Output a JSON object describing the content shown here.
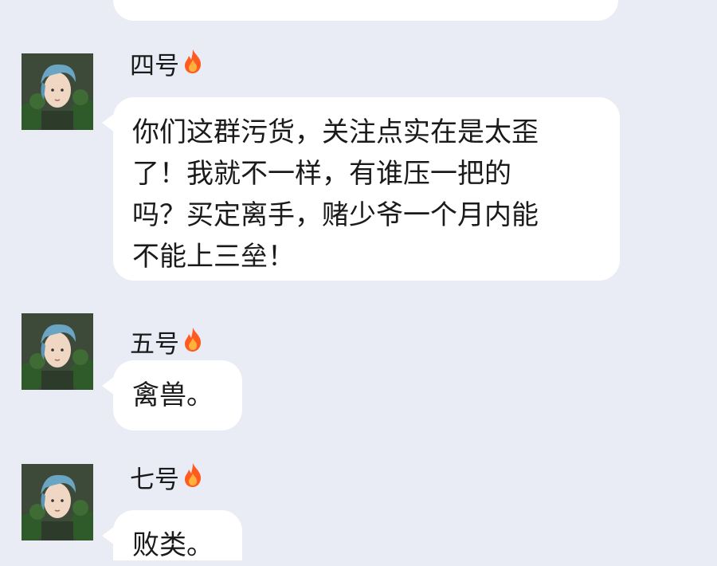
{
  "colors": {
    "background": "#e9ebf5",
    "bubble": "#ffffff",
    "text": "#1a1a1a",
    "flame_outer": "#ff5a1f",
    "flame_inner": "#ffb13b",
    "avatar_hair": "#6aa6c4",
    "avatar_foliage": "#2f5a2a"
  },
  "messages": [
    {
      "sender": "",
      "text": ""
    },
    {
      "sender": "四号",
      "badge_icon": "flame-icon",
      "text": "你们这群污货，关注点实在是太歪\n了！我就不一样，有谁压一把的\n吗？买定离手，赌少爷一个月内能\n不能上三垒！"
    },
    {
      "sender": "五号",
      "badge_icon": "flame-icon",
      "text": "禽兽。"
    },
    {
      "sender": "七号",
      "badge_icon": "flame-icon",
      "text": "败类。"
    }
  ]
}
